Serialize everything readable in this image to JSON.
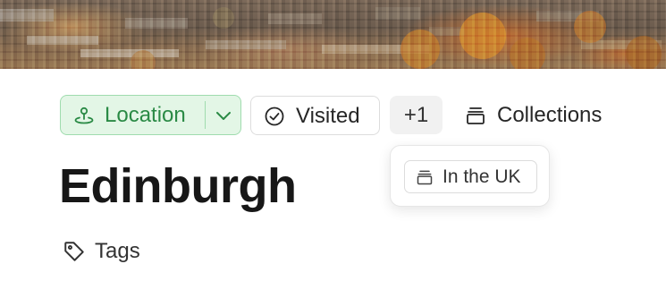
{
  "banner": {
    "image_description": ""
  },
  "properties": {
    "location_label": "Location",
    "visited_label": "Visited",
    "more_count_label": "+1",
    "collections_label": "Collections"
  },
  "collections_popover": {
    "items": [
      {
        "label": "In the UK",
        "icon": "collection-stack-icon"
      }
    ]
  },
  "page": {
    "title": "Edinburgh",
    "tags_label": "Tags"
  },
  "colors": {
    "location_bg": "#e3f6e6",
    "location_border": "#9fdcae",
    "location_text": "#2a8a45",
    "more_bg": "#f1f1f1"
  },
  "icons": {
    "location": "map-pin-icon",
    "location_dropdown": "chevron-down-icon",
    "visited": "check-circle-icon",
    "collections": "collection-stack-icon",
    "tags": "tag-icon"
  }
}
